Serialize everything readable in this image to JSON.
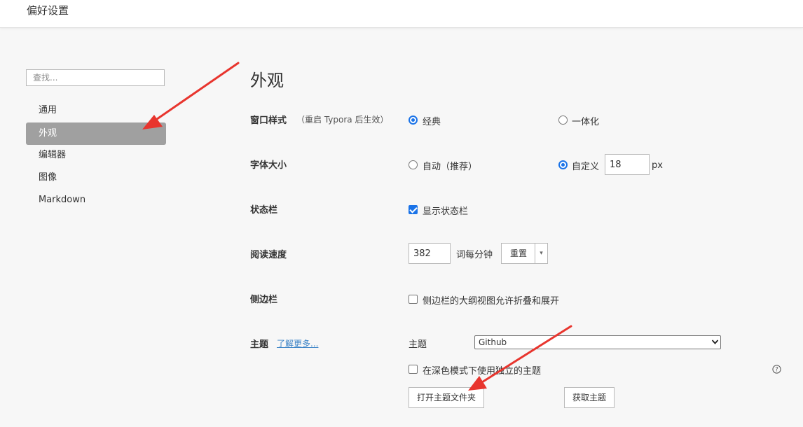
{
  "window": {
    "title": "偏好设置"
  },
  "sidebar": {
    "search_placeholder": "查找...",
    "items": [
      {
        "label": "通用"
      },
      {
        "label": "外观",
        "active": true
      },
      {
        "label": "编辑器"
      },
      {
        "label": "图像"
      },
      {
        "label": "Markdown"
      }
    ]
  },
  "main": {
    "title": "外观",
    "window_style": {
      "label": "窗口样式",
      "note": "（重启 Typora 后生效）",
      "options": [
        {
          "label": "经典",
          "selected": true
        },
        {
          "label": "一体化",
          "selected": false
        }
      ]
    },
    "font_size": {
      "label": "字体大小",
      "options": [
        {
          "label": "自动（推荐）",
          "selected": false
        },
        {
          "label": "自定义",
          "selected": true
        }
      ],
      "value": "18",
      "unit": "px"
    },
    "status_bar": {
      "label": "状态栏",
      "checkbox_label": "显示状态栏",
      "checked": true
    },
    "reading_speed": {
      "label": "阅读速度",
      "value": "382",
      "unit": "词每分钟",
      "reset_label": "重置",
      "dropdown_glyph": "▾"
    },
    "sidebar_setting": {
      "label": "侧边栏",
      "checkbox_label": "侧边栏的大纲视图允许折叠和展开",
      "checked": false
    },
    "theme": {
      "label": "主题",
      "learn_more": "了解更多...",
      "select_label": "主题",
      "selected": "Github",
      "dark_mode_label": "在深色模式下使用独立的主题",
      "dark_mode_checked": false,
      "open_folder_label": "打开主题文件夹",
      "get_themes_label": "获取主题"
    }
  },
  "colors": {
    "accent": "#1a73e8",
    "active_nav": "#a0a0a0",
    "link": "#3b83c6",
    "annotation_arrow": "#e8352e"
  }
}
